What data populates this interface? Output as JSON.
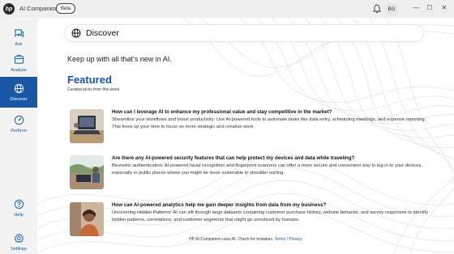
{
  "titlebar": {
    "logo_text": "hp",
    "app_title": "AI Companion",
    "beta_label": "Beta",
    "avatar_initials": "BG",
    "minimize": "—",
    "maximize": "☐",
    "close": "✕"
  },
  "sidebar": {
    "items": [
      {
        "label": "Ask",
        "icon": "chat-icon",
        "active": false
      },
      {
        "label": "Analyze",
        "icon": "analyze-icon",
        "active": false
      },
      {
        "label": "Discover",
        "icon": "globe-icon",
        "active": true
      },
      {
        "label": "Perform",
        "icon": "gauge-icon",
        "active": false
      },
      {
        "label": "Help",
        "icon": "help-icon",
        "active": false
      },
      {
        "label": "Settings",
        "icon": "gear-icon",
        "active": false
      }
    ]
  },
  "search": {
    "label": "Discover"
  },
  "main": {
    "tagline": "Keep up with all that's new in AI.",
    "featured_heading": "Featured",
    "curated_caption": "Curated picks from this week"
  },
  "cards": [
    {
      "title": "How can I leverage AI to enhance my professional value and stay competitive in the market?",
      "body": "Streamline your workflows and boost productivity: Use AI-powered tools to automate tasks like data entry, scheduling meetings, and expense reporting. This frees up your time to focus on more strategic and creative work.",
      "image": "laptop-photo"
    },
    {
      "title": "Are there any AI-powered security features that can help protect my devices and data while traveling?",
      "body": "Biometric authentication: AI-powered facial recognition and fingerprint scanners can offer a more secure and convenient way to log in to your devices, especially in public places where you might be more vulnerable to shoulder surfing.",
      "image": "travel-photo"
    },
    {
      "title": "How can AI-powered analytics help me gain deeper insights from data from my business?",
      "body": "Uncovering Hidden Patterns: AI can sift through large datasets containing customer purchase history, website behavior, and survey responses to identify hidden patterns, correlations, and customer segments that might go unnoticed by humans.",
      "image": "person-photo"
    }
  ],
  "footer": {
    "disclaimer": "HP AI Companion uses AI. Check for mistakes.",
    "terms_link": "Terms",
    "separator": "/",
    "privacy_link": "Privacy"
  },
  "colors": {
    "accent": "#1a56a6",
    "sidebar_bg": "#f3f3f3",
    "main_bg": "#ffffff"
  }
}
